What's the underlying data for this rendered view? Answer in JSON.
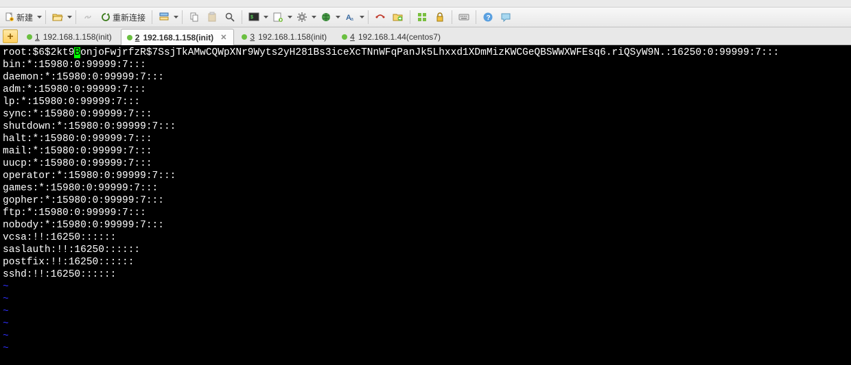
{
  "toolbar": {
    "new_label": "新建",
    "reconnect_label": "重新连接"
  },
  "tabs": [
    {
      "accel": "1",
      "label": "192.168.1.158(init)",
      "active": false
    },
    {
      "accel": "2",
      "label": "192.168.1.158(init)",
      "active": true
    },
    {
      "accel": "3",
      "label": "192.168.1.158(init)",
      "active": false
    },
    {
      "accel": "4",
      "label": "192.168.1.44(centos7)",
      "active": false
    }
  ],
  "terminal": {
    "root_pre": "root:$6$2kt9",
    "root_cursor": "B",
    "root_post": "onjoFwjrfzR$7SsjTkAMwCQWpXNr9Wyts2yH281Bs3iceXcTNnWFqPanJk5Lhxxd1XDmMizKWCGeQBSWWXWFEsq6.riQSyW9N.:16250:0:99999:7:::",
    "lines": [
      "bin:*:15980:0:99999:7:::",
      "daemon:*:15980:0:99999:7:::",
      "adm:*:15980:0:99999:7:::",
      "lp:*:15980:0:99999:7:::",
      "sync:*:15980:0:99999:7:::",
      "shutdown:*:15980:0:99999:7:::",
      "halt:*:15980:0:99999:7:::",
      "mail:*:15980:0:99999:7:::",
      "uucp:*:15980:0:99999:7:::",
      "operator:*:15980:0:99999:7:::",
      "games:*:15980:0:99999:7:::",
      "gopher:*:15980:0:99999:7:::",
      "ftp:*:15980:0:99999:7:::",
      "nobody:*:15980:0:99999:7:::",
      "vcsa:!!:16250::::::",
      "saslauth:!!:16250::::::",
      "postfix:!!:16250::::::",
      "sshd:!!:16250::::::"
    ],
    "tilde_count": 6,
    "tilde_char": "~"
  }
}
